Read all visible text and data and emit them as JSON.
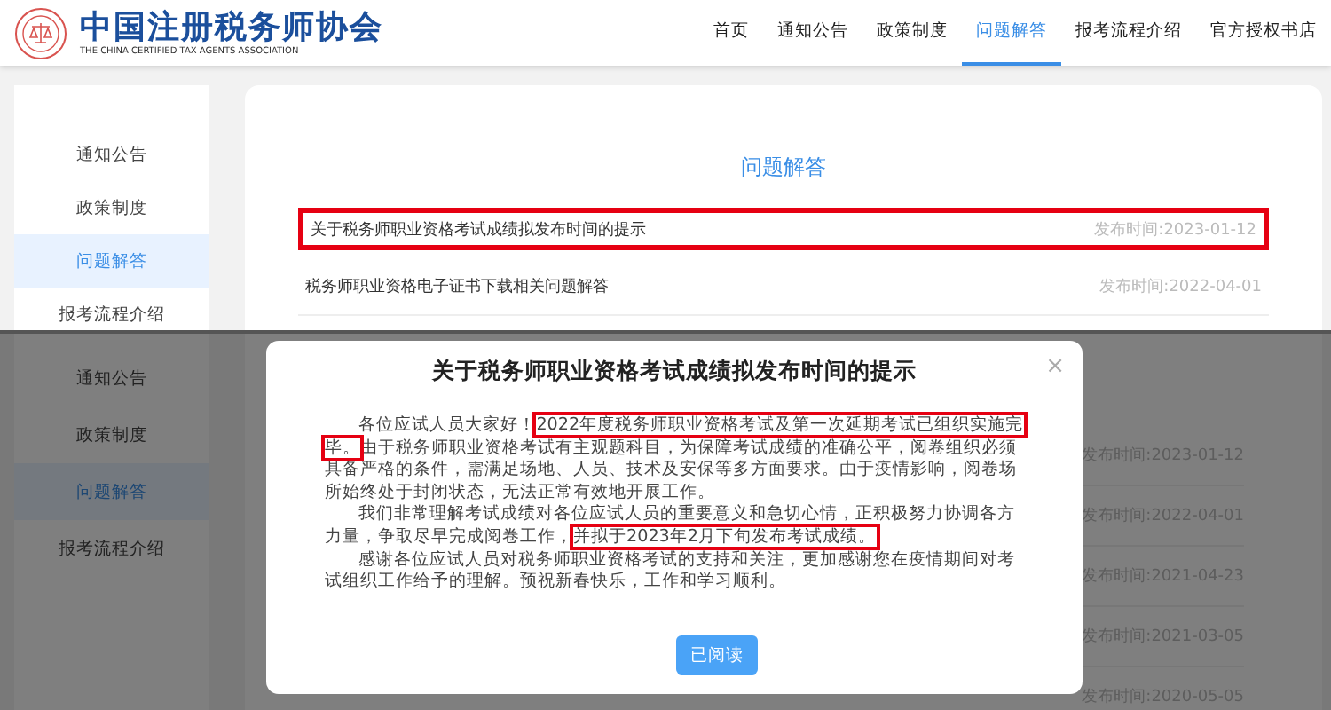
{
  "top_view": {
    "header": {
      "logo_title": "中国注册税务师协会",
      "logo_subtitle": "THE CHINA CERTIFIED TAX AGENTS ASSOCIATION",
      "nav": [
        {
          "label": "首页",
          "selected": false
        },
        {
          "label": "通知公告",
          "selected": false
        },
        {
          "label": "政策制度",
          "selected": false
        },
        {
          "label": "问题解答",
          "selected": true
        },
        {
          "label": "报考流程介绍",
          "selected": false
        },
        {
          "label": "官方授权书店",
          "selected": false
        }
      ]
    },
    "sidebar": [
      {
        "label": "通知公告",
        "selected": false
      },
      {
        "label": "政策制度",
        "selected": false
      },
      {
        "label": "问题解答",
        "selected": true
      },
      {
        "label": "报考流程介绍",
        "selected": false
      }
    ],
    "section_title": "问题解答",
    "articles": [
      {
        "title": "关于税务师职业资格考试成绩拟发布时间的提示",
        "date": "发布时间:2023-01-12",
        "highlighted": true
      },
      {
        "title": "税务师职业资格电子证书下载相关问题解答",
        "date": "发布时间:2022-04-01",
        "highlighted": false
      }
    ]
  },
  "modal_view": {
    "sidebar": [
      {
        "label": "通知公告",
        "selected": false
      },
      {
        "label": "政策制度",
        "selected": false
      },
      {
        "label": "问题解答",
        "selected": true
      },
      {
        "label": "报考流程介绍",
        "selected": false
      }
    ],
    "article_dates": [
      "发布时间:2023-01-12",
      "发布时间:2022-04-01",
      "发布时间:2021-04-23",
      "发布时间:2021-03-05",
      "发布时间:2020-05-05"
    ],
    "modal": {
      "title": "关于税务师职业资格考试成绩拟发布时间的提示",
      "close": "×",
      "paragraphs": [
        {
          "segments": [
            {
              "text": "各位应试人员大家好！",
              "highlighted": false
            },
            {
              "text": "2022年度税务师职业资格考试及第一次延期考试已组织实施完毕。",
              "highlighted": true
            },
            {
              "text": "由于税务师职业资格考试有主观题科目，为保障考试成绩的准确公平，阅卷组织必须具备严格的条件，需满足场地、人员、技术及安保等多方面要求。由于疫情影响，阅卷场所始终处于封闭状态，无法正常有效地开展工作。",
              "highlighted": false
            }
          ]
        },
        {
          "segments": [
            {
              "text": "我们非常理解考试成绩对各位应试人员的重要意义和急切心情，正积极努力协调各方力量，争取尽早完成阅卷工作，",
              "highlighted": false
            },
            {
              "text": "并拟于2023年2月下旬发布考试成绩。",
              "highlighted": true
            }
          ]
        },
        {
          "segments": [
            {
              "text": "感谢各位应试人员对税务师职业资格考试的支持和关注，更加感谢您在疫情期间对考试组织工作给予的理解。预祝新春快乐，工作和学习顺利。",
              "highlighted": false
            }
          ]
        }
      ],
      "button": "已阅读"
    }
  }
}
